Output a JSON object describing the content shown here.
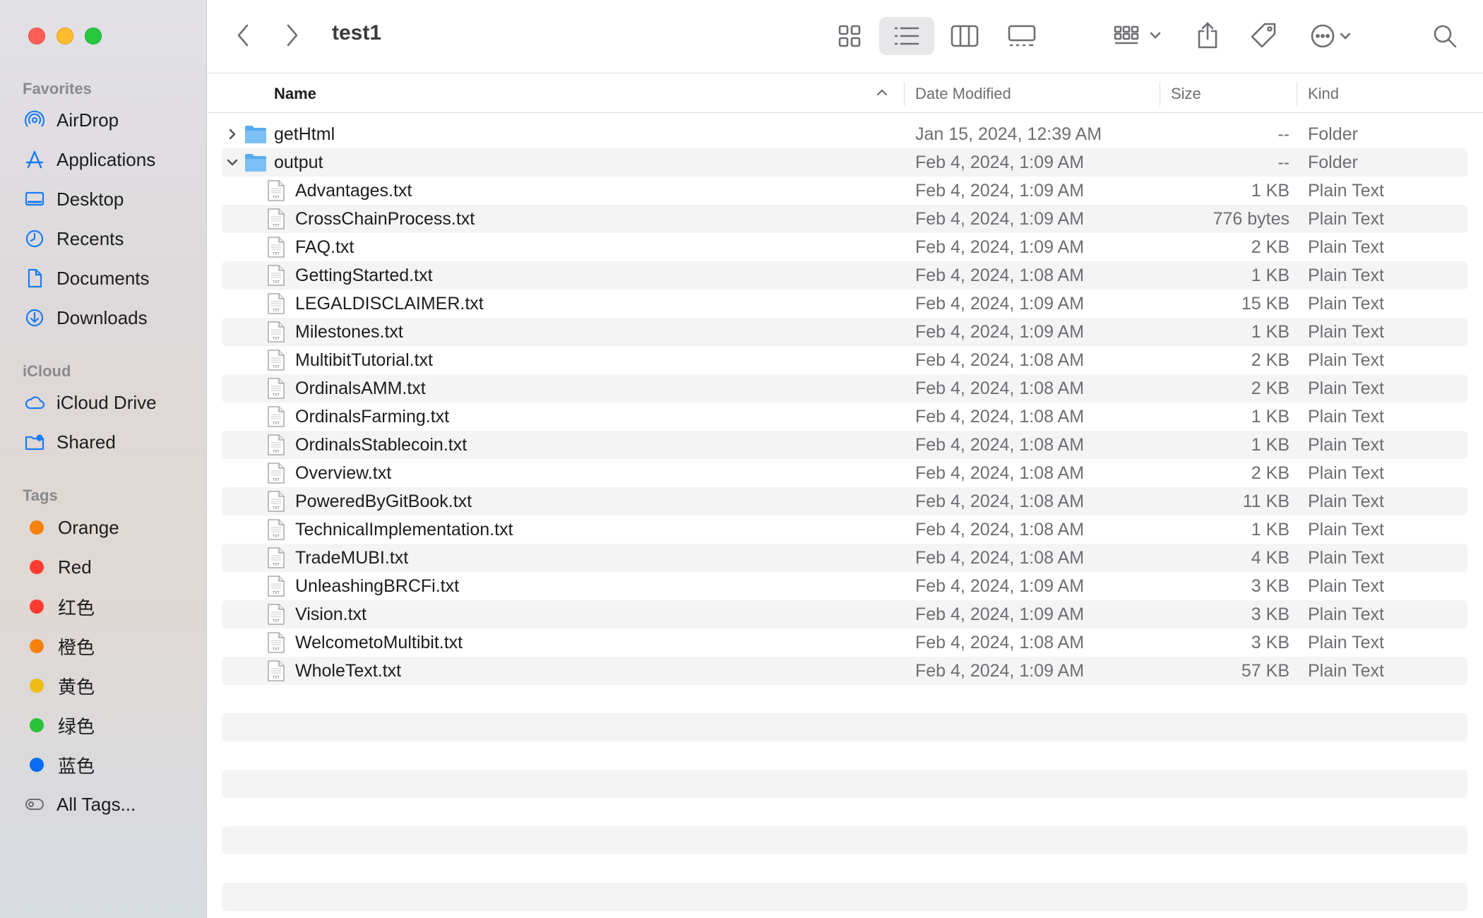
{
  "window": {
    "title": "test1"
  },
  "sidebar": {
    "favorites_label": "Favorites",
    "favorites": [
      {
        "label": "AirDrop",
        "icon": "airdrop-icon"
      },
      {
        "label": "Applications",
        "icon": "applications-icon"
      },
      {
        "label": "Desktop",
        "icon": "desktop-icon"
      },
      {
        "label": "Recents",
        "icon": "clock-icon"
      },
      {
        "label": "Documents",
        "icon": "document-icon"
      },
      {
        "label": "Downloads",
        "icon": "download-icon"
      }
    ],
    "icloud_label": "iCloud",
    "icloud": [
      {
        "label": "iCloud Drive",
        "icon": "cloud-icon"
      },
      {
        "label": "Shared",
        "icon": "shared-folder-icon"
      }
    ],
    "tags_label": "Tags",
    "tags": [
      {
        "label": "Orange",
        "color": "#f5820b"
      },
      {
        "label": "Red",
        "color": "#fd3b30"
      },
      {
        "label": "红色",
        "color": "#fd3b30"
      },
      {
        "label": "橙色",
        "color": "#f5820b"
      },
      {
        "label": "黄色",
        "color": "#f0bb12"
      },
      {
        "label": "绿色",
        "color": "#29c138"
      },
      {
        "label": "蓝色",
        "color": "#0a6cf2"
      }
    ],
    "all_tags_label": "All Tags..."
  },
  "columns": {
    "name": "Name",
    "date": "Date Modified",
    "size": "Size",
    "kind": "Kind"
  },
  "rows": [
    {
      "name": "getHtml",
      "date": "Jan 15, 2024, 12:39 AM",
      "size": "--",
      "kind": "Folder",
      "type": "folder",
      "expanded": false
    },
    {
      "name": "output",
      "date": "Feb 4, 2024, 1:09 AM",
      "size": "--",
      "kind": "Folder",
      "type": "folder",
      "expanded": true
    },
    {
      "name": "Advantages.txt",
      "date": "Feb 4, 2024, 1:09 AM",
      "size": "1 KB",
      "kind": "Plain Text",
      "type": "file"
    },
    {
      "name": "CrossChainProcess.txt",
      "date": "Feb 4, 2024, 1:09 AM",
      "size": "776 bytes",
      "kind": "Plain Text",
      "type": "file"
    },
    {
      "name": "FAQ.txt",
      "date": "Feb 4, 2024, 1:09 AM",
      "size": "2 KB",
      "kind": "Plain Text",
      "type": "file"
    },
    {
      "name": "GettingStarted.txt",
      "date": "Feb 4, 2024, 1:08 AM",
      "size": "1 KB",
      "kind": "Plain Text",
      "type": "file"
    },
    {
      "name": "LEGALDISCLAIMER.txt",
      "date": "Feb 4, 2024, 1:09 AM",
      "size": "15 KB",
      "kind": "Plain Text",
      "type": "file"
    },
    {
      "name": "Milestones.txt",
      "date": "Feb 4, 2024, 1:09 AM",
      "size": "1 KB",
      "kind": "Plain Text",
      "type": "file"
    },
    {
      "name": "MultibitTutorial.txt",
      "date": "Feb 4, 2024, 1:08 AM",
      "size": "2 KB",
      "kind": "Plain Text",
      "type": "file"
    },
    {
      "name": "OrdinalsAMM.txt",
      "date": "Feb 4, 2024, 1:08 AM",
      "size": "2 KB",
      "kind": "Plain Text",
      "type": "file"
    },
    {
      "name": "OrdinalsFarming.txt",
      "date": "Feb 4, 2024, 1:08 AM",
      "size": "1 KB",
      "kind": "Plain Text",
      "type": "file"
    },
    {
      "name": "OrdinalsStablecoin.txt",
      "date": "Feb 4, 2024, 1:08 AM",
      "size": "1 KB",
      "kind": "Plain Text",
      "type": "file"
    },
    {
      "name": "Overview.txt",
      "date": "Feb 4, 2024, 1:08 AM",
      "size": "2 KB",
      "kind": "Plain Text",
      "type": "file"
    },
    {
      "name": "PoweredByGitBook.txt",
      "date": "Feb 4, 2024, 1:08 AM",
      "size": "11 KB",
      "kind": "Plain Text",
      "type": "file"
    },
    {
      "name": "TechnicalImplementation.txt",
      "date": "Feb 4, 2024, 1:08 AM",
      "size": "1 KB",
      "kind": "Plain Text",
      "type": "file"
    },
    {
      "name": "TradeMUBI.txt",
      "date": "Feb 4, 2024, 1:08 AM",
      "size": "4 KB",
      "kind": "Plain Text",
      "type": "file"
    },
    {
      "name": "UnleashingBRCFi.txt",
      "date": "Feb 4, 2024, 1:09 AM",
      "size": "3 KB",
      "kind": "Plain Text",
      "type": "file"
    },
    {
      "name": "Vision.txt",
      "date": "Feb 4, 2024, 1:09 AM",
      "size": "3 KB",
      "kind": "Plain Text",
      "type": "file"
    },
    {
      "name": "WelcometoMultibit.txt",
      "date": "Feb 4, 2024, 1:08 AM",
      "size": "3 KB",
      "kind": "Plain Text",
      "type": "file"
    },
    {
      "name": "WholeText.txt",
      "date": "Feb 4, 2024, 1:09 AM",
      "size": "57 KB",
      "kind": "Plain Text",
      "type": "file"
    }
  ],
  "txt_icon_label": "TXT"
}
